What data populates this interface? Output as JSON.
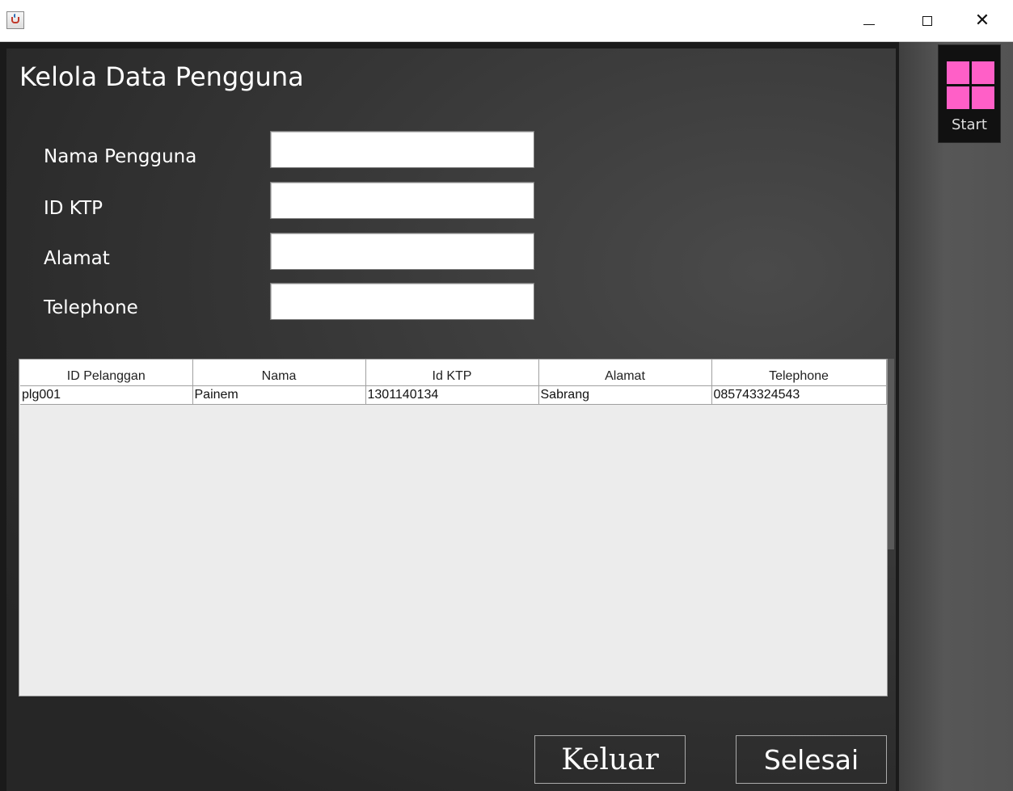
{
  "window": {
    "title": "",
    "icons": {
      "app": "java-cup-icon",
      "minimize": "minimize-icon",
      "maximize": "maximize-icon",
      "close": "close-icon"
    },
    "close_glyph": "✕"
  },
  "start_tile": {
    "label": "Start",
    "icon": "windows-logo-icon",
    "accent": "#ff5fc7"
  },
  "page": {
    "title": "Kelola Data Pengguna"
  },
  "form": {
    "nama_pengguna": {
      "label": "Nama Pengguna",
      "value": ""
    },
    "id_ktp": {
      "label": "ID KTP",
      "value": ""
    },
    "alamat": {
      "label": "Alamat",
      "value": ""
    },
    "telephone": {
      "label": "Telephone",
      "value": ""
    }
  },
  "table": {
    "columns": [
      "ID Pelanggan",
      "Nama",
      "Id KTP",
      "Alamat",
      "Telephone"
    ],
    "rows": [
      [
        "plg001",
        "Painem",
        "1301140134",
        "Sabrang",
        "085743324543"
      ]
    ]
  },
  "buttons": {
    "keluar": "Keluar",
    "selesai": "Selesai"
  }
}
